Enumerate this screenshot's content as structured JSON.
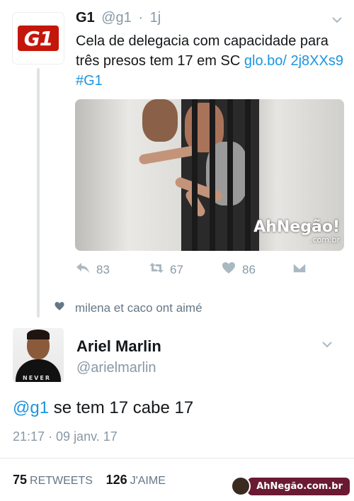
{
  "tweet1": {
    "name": "G1",
    "handle": "@g1",
    "time": "1j",
    "text_plain": "Cela de delegacia com capacidade para três presos tem 17 em SC ",
    "link_text": "glo.bo/ 2j8XXs9",
    "hashtag": "#G1",
    "avatar_logo": "G1",
    "image_watermark": "AhNegão!",
    "image_watermark_sub": ".com.br",
    "actions": {
      "reply_count": "83",
      "retweet_count": "67",
      "like_count": "86"
    },
    "liked_by": "milena et caco ont aimé"
  },
  "tweet2": {
    "name": "Ariel Marlin",
    "handle": "@arielmarlin",
    "avatar_shirt_text": "NEVER",
    "mention": "@g1",
    "text": " se tem 17 cabe 17",
    "timestamp": "21:17 · 09 janv. 17",
    "retweets_count": "75",
    "retweets_label": "RETWEETS",
    "likes_count": "126",
    "likes_label": "J'AIME"
  },
  "footer_watermark": "AhNegão.com.br",
  "colors": {
    "link": "#1b95e0",
    "muted": "#8899a6",
    "g1_red": "#c4170c"
  },
  "icons": [
    "reply-icon",
    "retweet-icon",
    "heart-icon",
    "dm-icon",
    "chevron-down-icon"
  ]
}
